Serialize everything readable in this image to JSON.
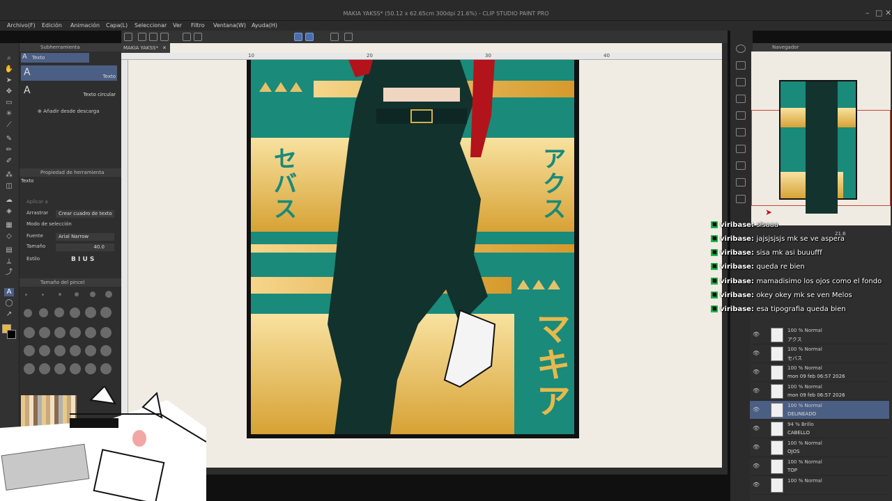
{
  "window": {
    "title": "MAKIA YAKSS* (50.12 x 62.65cm 300dpi 21.6%) - CLIP STUDIO PAINT PRO"
  },
  "menu": [
    "Archivo(F)",
    "Edición",
    "Animación",
    "Capa(L)",
    "Seleccionar",
    "Ver",
    "Filtro",
    "Ventana(W)",
    "Ayuda(H)"
  ],
  "subtool": {
    "header": "Subherramienta",
    "group": "Texto",
    "items": [
      {
        "label": "Texto"
      },
      {
        "label": "Texto circular"
      }
    ],
    "add_link": "Añadir desde descarga"
  },
  "toolprop": {
    "header": "Propiedad de herramienta",
    "name": "Texto",
    "apply_label": "Aplicar a",
    "rows": [
      {
        "label": "Arrastrar",
        "value": "Crear cuadro de texto"
      },
      {
        "label": "Modo de selección",
        "value": ""
      },
      {
        "label": "Fuente",
        "value": "Arial Narrow"
      },
      {
        "label": "Tamaño",
        "value": "40.0"
      },
      {
        "label": "Estilo",
        "value": "B I U S"
      }
    ]
  },
  "brushsize": {
    "header": "Tamaño del pincel"
  },
  "document": {
    "tab": "MAKIA YAKSS*"
  },
  "rulers": [
    "10",
    "20",
    "30",
    "40"
  ],
  "poster": {
    "kana_left": "セバス",
    "kana_right": "アクス",
    "kana_bottom": "マキア"
  },
  "navigator": {
    "header": "Navegador",
    "zoom": "21.6"
  },
  "layers": [
    {
      "blend": "100 % Normal",
      "name": "アクス"
    },
    {
      "blend": "100 % Normal",
      "name": "セバス"
    },
    {
      "blend": "100 % Normal",
      "name": "mon 09 feb 06:57  2026"
    },
    {
      "blend": "100 % Normal",
      "name": "mon 09 feb 06:57  2026"
    },
    {
      "blend": "100 % Normal",
      "name": "DELINEADO"
    },
    {
      "blend": "94 % Brillo",
      "name": "CABELLO"
    },
    {
      "blend": "100 % Normal",
      "name": "OJOS"
    },
    {
      "blend": "100 % Normal",
      "name": "TOP"
    },
    {
      "blend": "100 % Normal",
      "name": ""
    }
  ],
  "chat": [
    {
      "user": "viribase:",
      "msg": "sisaaa"
    },
    {
      "user": "viribase:",
      "msg": "jajsjsjsjs mk se ve aspera"
    },
    {
      "user": "viribase:",
      "msg": "sisa mk asi buuufff"
    },
    {
      "user": "viribase:",
      "msg": "queda re bien"
    },
    {
      "user": "viribase:",
      "msg": "mamadisimo los ojos como el fondo"
    },
    {
      "user": "viribase:",
      "msg": "okey okey mk se ven Melos"
    },
    {
      "user": "viribase:",
      "msg": "esa tipografia queda bien"
    }
  ],
  "colors": {
    "teal": "#1a8a7a",
    "gold": "#e7b94b",
    "select": "#4b5e84"
  }
}
